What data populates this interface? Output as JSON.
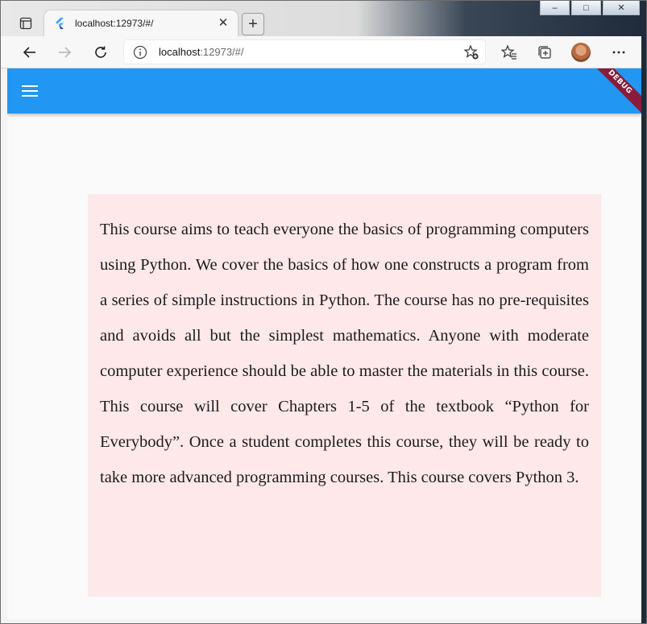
{
  "browser": {
    "tab": {
      "title": "localhost:12973/#/",
      "close_label": "✕"
    },
    "new_tab_label": "+",
    "address": {
      "host": "localhost",
      "path": ":12973/#/"
    },
    "window_controls": {
      "minimize": "–",
      "maximize": "□",
      "close": "✕"
    }
  },
  "app": {
    "debug_banner": "DEBUG",
    "colors": {
      "app_bar": "#2196f3",
      "card_background": "#ffe8ea",
      "page_background": "#fafafa"
    },
    "course_description": "This course aims to teach everyone the basics of programming computers using Python. We cover the basics of how one constructs a program from a series of simple instructions in Python. The course has no pre-requisites and avoids all but the simplest mathematics. Anyone with moderate computer experience should be able to master the materials in this course. This course will cover Chapters 1-5 of the textbook “Python for Everybody”. Once a student completes this course, they will be ready to take more advanced programming courses. This course covers Python 3."
  },
  "icons": {
    "tab_actions": "tab-actions-icon",
    "favicon": "flutter-favicon",
    "back": "back-arrow-icon",
    "forward": "forward-arrow-icon",
    "refresh": "refresh-icon",
    "info": "info-icon",
    "add_favorite": "star-plus-icon",
    "favorites": "favorites-icon",
    "collections": "collections-icon",
    "profile": "profile-avatar",
    "more": "more-icon",
    "menu": "hamburger-menu-icon"
  }
}
